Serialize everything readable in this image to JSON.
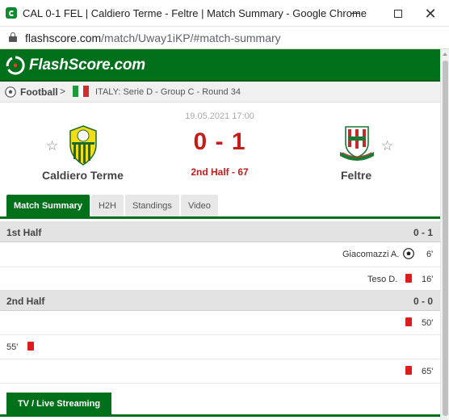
{
  "browser": {
    "tab_title": "CAL 0-1 FEL | Caldiero Terme - Feltre | Match Summary - Google Chrome",
    "url_domain": "flashscore.com",
    "url_path": "/match/Uway1iKP/#match-summary"
  },
  "site": {
    "logo_text": "FlashScore.com",
    "brand_color": "#00701a"
  },
  "breadcrumb": {
    "sport": "Football",
    "chevron": ">",
    "league": "ITALY: Serie D - Group C - Round 34"
  },
  "match": {
    "datetime": "19.05.2021 17:00",
    "score": "0 - 1",
    "status": "2nd Half - 67",
    "home_team": "Caldiero Terme",
    "away_team": "Feltre",
    "star_glyph": "☆"
  },
  "tabs": [
    {
      "label": "Match Summary",
      "active": true
    },
    {
      "label": "H2H",
      "active": false
    },
    {
      "label": "Standings",
      "active": false
    },
    {
      "label": "Video",
      "active": false
    }
  ],
  "summary": {
    "first_half": {
      "label": "1st Half",
      "score": "0 - 1",
      "events": [
        {
          "side": "away",
          "player": "Giacomazzi A.",
          "type": "goal-icon",
          "minute": "6'"
        },
        {
          "side": "away",
          "player": "Teso D.",
          "type": "red-card-icon",
          "minute": "16'"
        }
      ]
    },
    "second_half": {
      "label": "2nd Half",
      "score": "0 - 0",
      "events": [
        {
          "side": "away",
          "player": "",
          "type": "red-card-icon",
          "minute": "50'"
        },
        {
          "side": "home",
          "player": "",
          "type": "red-card-icon",
          "minute": "55'"
        },
        {
          "side": "away",
          "player": "",
          "type": "red-card-icon",
          "minute": "65'"
        }
      ]
    }
  },
  "streaming": {
    "label": "TV / Live Streaming"
  },
  "colors": {
    "score_red": "#c41b1b",
    "card_red": "#dd1d1d"
  }
}
